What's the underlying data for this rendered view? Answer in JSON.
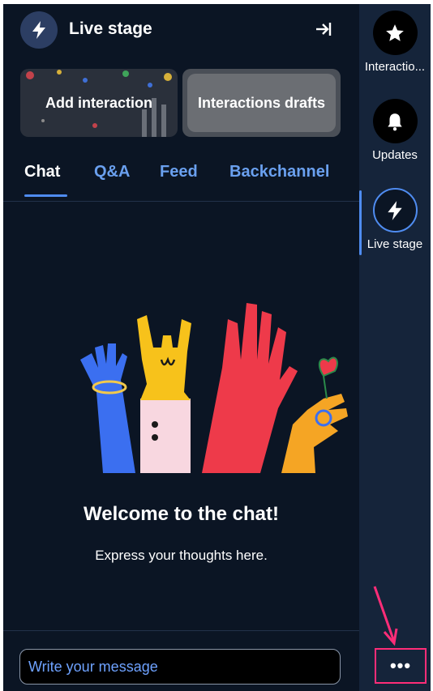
{
  "header": {
    "title": "Live stage"
  },
  "cards": [
    {
      "label": "Add interaction"
    },
    {
      "label": "Interactions drafts"
    }
  ],
  "tabs": [
    {
      "label": "Chat",
      "active": true
    },
    {
      "label": "Q&A"
    },
    {
      "label": "Feed"
    },
    {
      "label": "Backchannel"
    }
  ],
  "chat": {
    "welcome_title": "Welcome to the chat!",
    "welcome_subtitle": "Express your thoughts here.",
    "input_placeholder": "Write your message"
  },
  "sidebar": {
    "items": [
      {
        "label": "Interactio...",
        "icon": "star-icon"
      },
      {
        "label": "Updates",
        "icon": "bell-icon"
      },
      {
        "label": "Live stage",
        "icon": "lightning-icon",
        "active": true
      }
    ],
    "more_label": "•••"
  },
  "colors": {
    "background": "#0b1524",
    "sidebar": "#15243a",
    "accent": "#4f8cf0",
    "highlight": "#ff2d78"
  }
}
